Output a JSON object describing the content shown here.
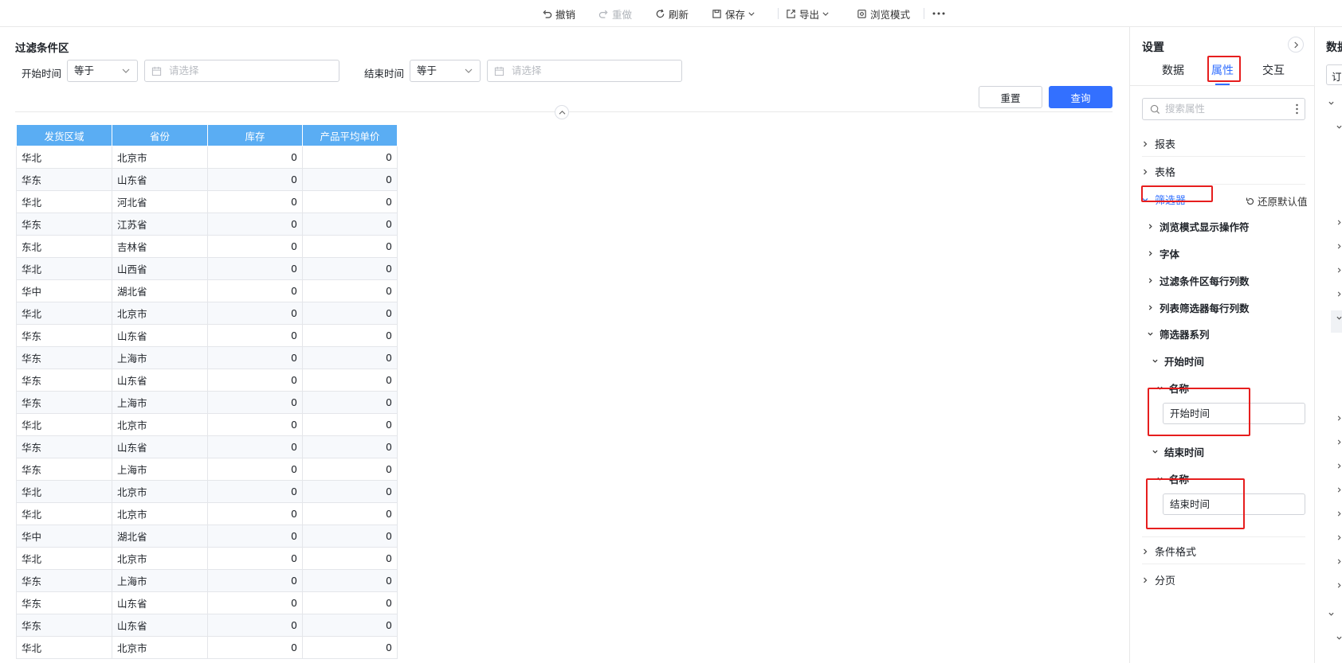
{
  "toolbar": {
    "undo": "撤销",
    "redo": "重做",
    "refresh": "刷新",
    "save": "保存",
    "export": "导出",
    "browse_mode": "浏览模式"
  },
  "filter": {
    "title": "过滤条件区",
    "start_label": "开始时间",
    "start_operator": "等于",
    "start_placeholder": "请选择",
    "end_label": "结束时间",
    "end_operator": "等于",
    "end_placeholder": "请选择",
    "reset": "重置",
    "query": "查询"
  },
  "table": {
    "columns": [
      "发货区域",
      "省份",
      "库存",
      "产品平均单价"
    ],
    "rows": [
      [
        "华北",
        "北京市",
        "0",
        "0"
      ],
      [
        "华东",
        "山东省",
        "0",
        "0"
      ],
      [
        "华北",
        "河北省",
        "0",
        "0"
      ],
      [
        "华东",
        "江苏省",
        "0",
        "0"
      ],
      [
        "东北",
        "吉林省",
        "0",
        "0"
      ],
      [
        "华北",
        "山西省",
        "0",
        "0"
      ],
      [
        "华中",
        "湖北省",
        "0",
        "0"
      ],
      [
        "华北",
        "北京市",
        "0",
        "0"
      ],
      [
        "华东",
        "山东省",
        "0",
        "0"
      ],
      [
        "华东",
        "上海市",
        "0",
        "0"
      ],
      [
        "华东",
        "山东省",
        "0",
        "0"
      ],
      [
        "华东",
        "上海市",
        "0",
        "0"
      ],
      [
        "华北",
        "北京市",
        "0",
        "0"
      ],
      [
        "华东",
        "山东省",
        "0",
        "0"
      ],
      [
        "华东",
        "上海市",
        "0",
        "0"
      ],
      [
        "华北",
        "北京市",
        "0",
        "0"
      ],
      [
        "华北",
        "北京市",
        "0",
        "0"
      ],
      [
        "华中",
        "湖北省",
        "0",
        "0"
      ],
      [
        "华北",
        "北京市",
        "0",
        "0"
      ],
      [
        "华东",
        "上海市",
        "0",
        "0"
      ],
      [
        "华东",
        "山东省",
        "0",
        "0"
      ],
      [
        "华东",
        "山东省",
        "0",
        "0"
      ],
      [
        "华北",
        "北京市",
        "0",
        "0"
      ]
    ]
  },
  "settings": {
    "title": "设置",
    "tabs": [
      "数据",
      "属性",
      "交互"
    ],
    "active_tab": "属性",
    "search_placeholder": "搜索属性",
    "sections": {
      "report": "报表",
      "grid": "表格",
      "filter": "筛选器",
      "conditional_format": "条件格式",
      "pagination": "分页"
    },
    "restore_default": "还原默认值",
    "filter_items": {
      "browse_show_operator": "浏览模式显示操作符",
      "font": "字体",
      "filter_columns_per_row": "过滤条件区每行列数",
      "list_columns_per_row": "列表筛选器每行列数",
      "series": "筛选器系列",
      "start_time": "开始时间",
      "end_time": "结束时间",
      "name_label": "名称",
      "start_name_value": "开始时间",
      "end_name_value": "结束时间"
    }
  },
  "data_panel": {
    "title": "数据",
    "input_value": "订"
  },
  "colors": {
    "accent": "#3370ff",
    "header": "#5aadf3",
    "highlight": "#e61e1e"
  }
}
